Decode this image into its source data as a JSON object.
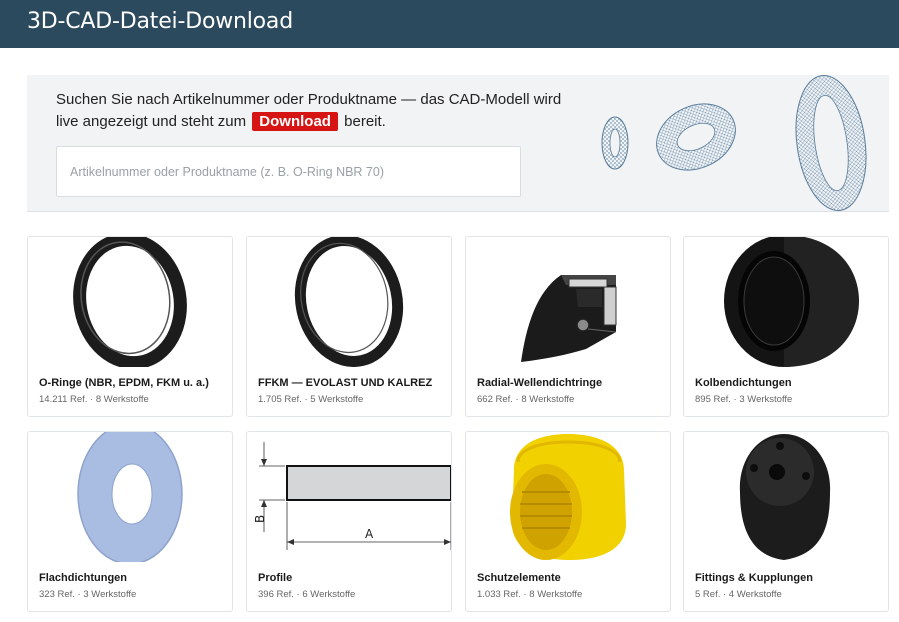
{
  "header": {
    "title": "3D-CAD-Datei-Download"
  },
  "hero": {
    "intro_before": "Suchen Sie nach Artikelnummer oder Produktname — das CAD-Modell wird live angezeigt und steht zum",
    "download_badge": "Download",
    "intro_after": "bereit.",
    "search": {
      "placeholder": "Artikelnummer oder Produktname (z. B. O-Ring NBR 70)",
      "value": ""
    }
  },
  "categories": [
    {
      "name": "O-Ringe (NBR, EPDM, FKM u. a.)",
      "meta": "14.211 Ref. · 8 Werkstoffe",
      "icon": "o-ring-icon"
    },
    {
      "name": "FFKM — EVOLAST UND KALREZ",
      "meta": "1.705 Ref. · 5 Werkstoffe",
      "icon": "ffkm-ring-icon"
    },
    {
      "name": "Radial-Wellendichtringe",
      "meta": "662 Ref. · 8 Werkstoffe",
      "icon": "shaft-seal-icon"
    },
    {
      "name": "Kolbendichtungen",
      "meta": "895 Ref. · 3 Werkstoffe",
      "icon": "piston-seal-icon"
    },
    {
      "name": "Flachdichtungen",
      "meta": "323 Ref. · 3 Werkstoffe",
      "icon": "flat-gasket-icon"
    },
    {
      "name": "Profile",
      "meta": "396 Ref. · 6 Werkstoffe",
      "icon": "profile-drawing-icon"
    },
    {
      "name": "Schutzelemente",
      "meta": "1.033 Ref. · 8 Werkstoffe",
      "icon": "protective-cap-icon"
    },
    {
      "name": "Fittings & Kupplungen",
      "meta": "5 Ref. · 4 Werkstoffe",
      "icon": "fitting-icon"
    }
  ],
  "profile_drawing": {
    "label_a": "A",
    "label_b": "B"
  }
}
